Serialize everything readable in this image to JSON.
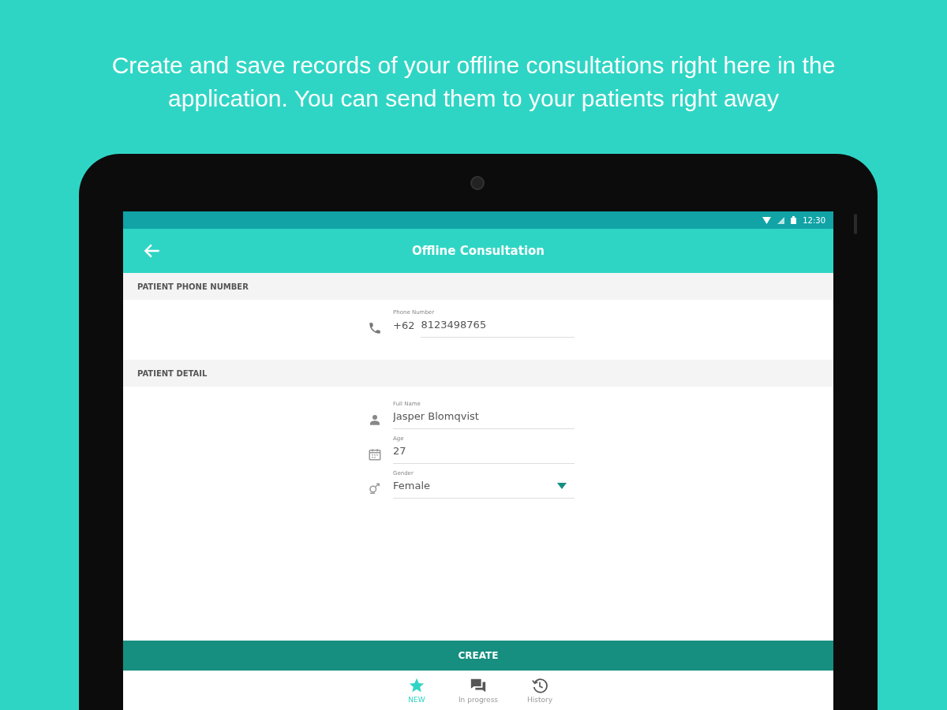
{
  "headline": "Create and save records of your offline consultations right here in the application. You can send them to your patients right away",
  "status_bar": {
    "time": "12:30"
  },
  "app_bar": {
    "title": "Offline Consultation"
  },
  "sections": [
    {
      "header": "PATIENT PHONE NUMBER",
      "fields": [
        {
          "kind": "phone",
          "label": "Phone Number",
          "prefix": "+62",
          "value": "8123498765"
        }
      ]
    },
    {
      "header": "PATIENT DETAIL",
      "fields": [
        {
          "kind": "name",
          "label": "Full Name",
          "value": "Jasper Blomqvist"
        },
        {
          "kind": "age",
          "label": "Age",
          "value": "27"
        },
        {
          "kind": "gender",
          "label": "Gender",
          "value": "Female"
        }
      ]
    }
  ],
  "create_button": "CREATE",
  "nav": [
    {
      "kind": "star",
      "label": "NEW",
      "selected": true
    },
    {
      "kind": "chat",
      "label": "In progress",
      "selected": false
    },
    {
      "kind": "history",
      "label": "History",
      "selected": false
    }
  ]
}
